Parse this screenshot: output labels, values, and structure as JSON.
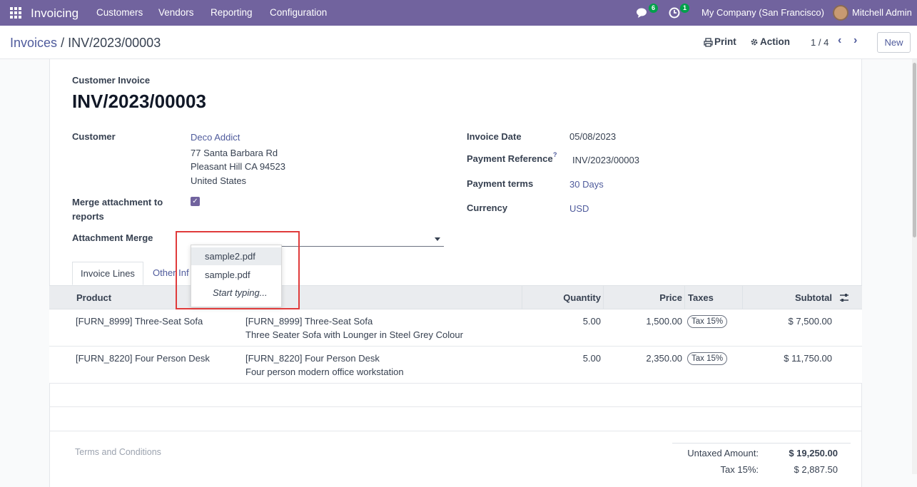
{
  "topbar": {
    "app_name": "Invoicing",
    "menu": [
      "Customers",
      "Vendors",
      "Reporting",
      "Configuration"
    ],
    "messages_badge": "6",
    "activities_badge": "1",
    "company": "My Company (San Francisco)",
    "user": "Mitchell Admin"
  },
  "control_panel": {
    "breadcrumb_parent": "Invoices",
    "breadcrumb_sep": "/",
    "breadcrumb_current": "INV/2023/00003",
    "print_label": "Print",
    "action_label": "Action",
    "pager": "1 / 4",
    "new_label": "New"
  },
  "form": {
    "doc_type": "Customer Invoice",
    "name": "INV/2023/00003",
    "customer_label": "Customer",
    "customer_name": "Deco Addict",
    "address_line1": "77 Santa Barbara Rd",
    "address_line2": "Pleasant Hill CA 94523",
    "address_line3": "United States",
    "merge_label_1": "Merge attachment to",
    "merge_label_2": "reports",
    "merge_checked": true,
    "attachment_merge_label": "Attachment Merge",
    "invoice_date_label": "Invoice Date",
    "invoice_date": "05/08/2023",
    "payment_ref_label": "Payment Reference",
    "payment_ref_help": "?",
    "payment_ref": "INV/2023/00003",
    "payment_terms_label": "Payment terms",
    "payment_terms": "30 Days",
    "currency_label": "Currency",
    "currency": "USD"
  },
  "dropdown": {
    "options": [
      "sample2.pdf",
      "sample.pdf"
    ],
    "hint": "Start typing..."
  },
  "tabs": {
    "invoice_lines": "Invoice Lines",
    "other_info": "Other Inf"
  },
  "table": {
    "headers": {
      "product": "Product",
      "quantity": "Quantity",
      "price": "Price",
      "taxes": "Taxes",
      "subtotal": "Subtotal"
    },
    "rows": [
      {
        "product": "[FURN_8999] Three-Seat Sofa",
        "label_line1": "[FURN_8999] Three-Seat Sofa",
        "label_line2": "Three Seater Sofa with Lounger in Steel Grey Colour",
        "quantity": "5.00",
        "price": "1,500.00",
        "tax": "Tax 15%",
        "subtotal": "$ 7,500.00"
      },
      {
        "product": "[FURN_8220] Four Person Desk",
        "label_line1": "[FURN_8220] Four Person Desk",
        "label_line2": "Four person modern office workstation",
        "quantity": "5.00",
        "price": "2,350.00",
        "tax": "Tax 15%",
        "subtotal": "$ 11,750.00"
      }
    ]
  },
  "footer": {
    "terms_placeholder": "Terms and Conditions",
    "untaxed_label": "Untaxed Amount:",
    "untaxed_value": "$ 19,250.00",
    "tax_label": "Tax 15%:",
    "tax_value": "$ 2,887.50"
  },
  "colors": {
    "navbar": "#71639e",
    "link": "#4f5b9c",
    "badge": "#00a04a",
    "highlight": "#e03b3b"
  }
}
